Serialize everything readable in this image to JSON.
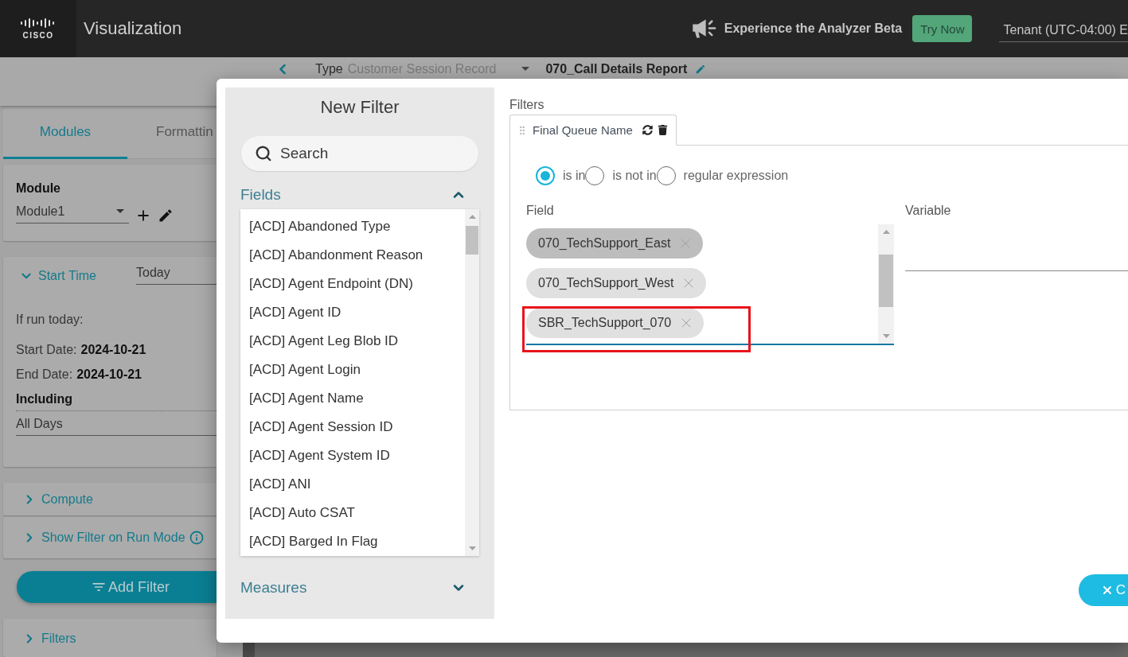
{
  "header": {
    "logo_text": "CISCO",
    "title": "Visualization",
    "announcement": "Experience the Analyzer Beta",
    "try_button": "Try Now",
    "tenant": "Tenant (UTC-04:00) E"
  },
  "toolbar": {
    "type_label": "Type",
    "type_value": "Customer Session Record",
    "report_name": "070_Call Details Report"
  },
  "sidebar": {
    "tabs": [
      {
        "label": "Modules",
        "selected": true
      },
      {
        "label": "Formattin",
        "selected": false
      }
    ],
    "module": {
      "label": "Module",
      "value": "Module1"
    },
    "start_time": {
      "label": "Start Time",
      "expanded": true,
      "range": "Today",
      "note": "If run today:",
      "start_date_label": "Start Date:",
      "start_date": "2024-10-21",
      "end_date_label": "End Date:",
      "end_date": "2024-10-21",
      "including_label": "Including",
      "including_value": "All Days"
    },
    "sections": [
      {
        "label": "Compute",
        "expanded": false,
        "info": false
      },
      {
        "label": "Show Filter on Run Mode",
        "expanded": false,
        "info": true
      }
    ],
    "add_filter_button": "Add Filter",
    "filters_section": {
      "label": "Filters",
      "expanded": false
    }
  },
  "dialog": {
    "title": "New Filter",
    "search": {
      "placeholder": "Search"
    },
    "fields": {
      "label": "Fields",
      "expanded": true,
      "items": [
        "[ACD] Abandoned Type",
        "[ACD] Abandonment Reason",
        "[ACD] Agent Endpoint (DN)",
        "[ACD] Agent ID",
        "[ACD] Agent Leg Blob ID",
        "[ACD] Agent Login",
        "[ACD] Agent Name",
        "[ACD] Agent Session ID",
        "[ACD] Agent System ID",
        "[ACD] ANI",
        "[ACD] Auto CSAT",
        "[ACD] Barged In Flag"
      ]
    },
    "measures": {
      "label": "Measures",
      "expanded": false
    },
    "filters_label": "Filters",
    "filter_tabs": [
      {
        "label": "Final Queue Name",
        "selected": true
      }
    ],
    "operators": [
      {
        "label": "is in",
        "selected": true
      },
      {
        "label": "is not in",
        "selected": false
      },
      {
        "label": "regular expression",
        "selected": false
      }
    ],
    "field_label": "Field",
    "values": [
      {
        "label": "070_TechSupport_East",
        "selected": true,
        "highlighted": false
      },
      {
        "label": "070_TechSupport_West",
        "selected": false,
        "highlighted": false
      },
      {
        "label": "SBR_TechSupport_070",
        "selected": false,
        "highlighted": true
      }
    ],
    "variable_label": "Variable",
    "cancel_button": "C"
  }
}
